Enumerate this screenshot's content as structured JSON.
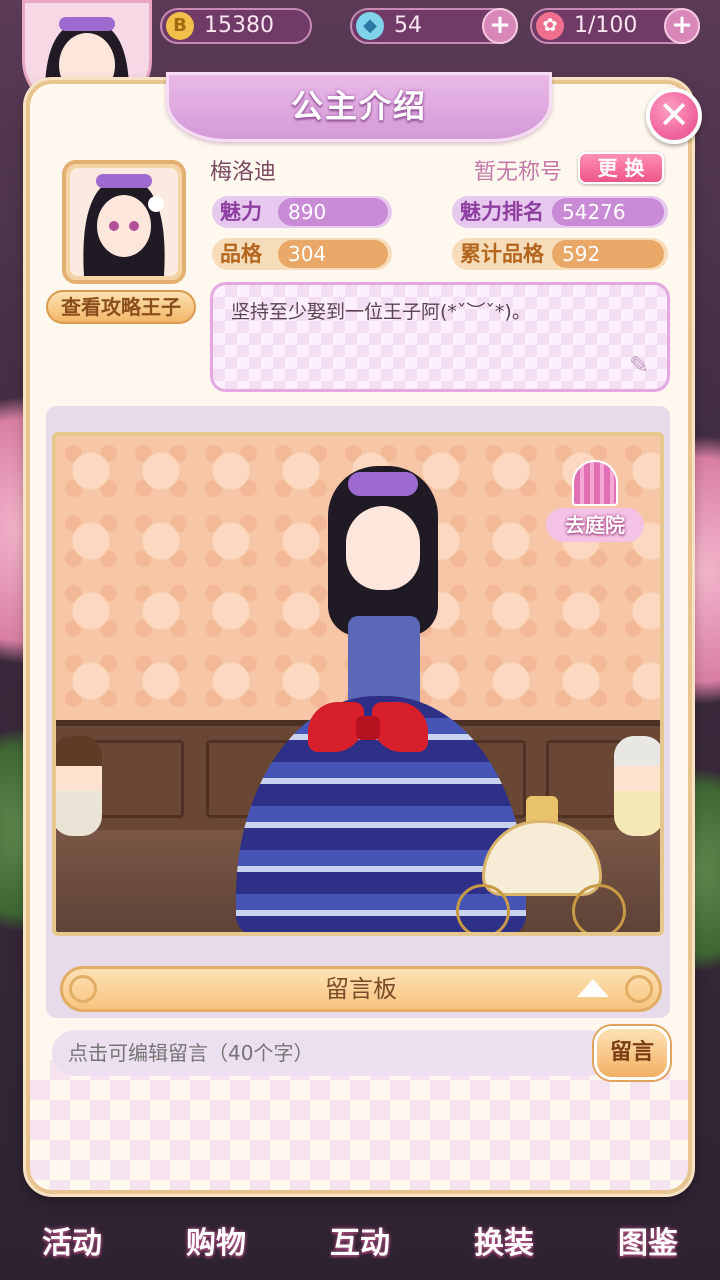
{
  "top_bar": {
    "gold": "15380",
    "gems": "54",
    "roses": "1/100"
  },
  "panel": {
    "title": "公主介绍",
    "view_prince_label": "查看攻略王子",
    "player_name": "梅洛迪",
    "title_status": "暂无称号",
    "change_label": "更 换",
    "stats": {
      "charm_label": "魅力",
      "charm_value": "890",
      "charm_rank_label": "魅力排名",
      "charm_rank_value": "54276",
      "quality_label": "品格",
      "quality_value": "304",
      "total_quality_label": "累计品格",
      "total_quality_value": "592"
    },
    "signature": "坚持至少娶到一位王子阿(*ˇ︶ˇ*)。",
    "courtyard_label": "去庭院",
    "message_board_label": "留言板",
    "message_input_placeholder": "点击可编辑留言（40个字）",
    "message_button_label": "留言"
  },
  "bottom_nav": [
    {
      "label": "活动"
    },
    {
      "label": "购物"
    },
    {
      "label": "互动"
    },
    {
      "label": "换装"
    },
    {
      "label": "图鉴"
    }
  ],
  "colors": {
    "panel_bg": "#fff8ee",
    "title_banner": "#d49ad9",
    "close_button": "#ee5f98",
    "charm_stat": "#c98ad6",
    "quality_stat": "#e9a868"
  }
}
